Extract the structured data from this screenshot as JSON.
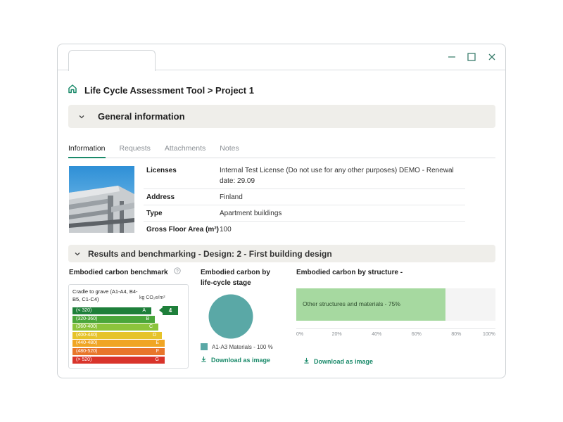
{
  "window": {
    "controls": {
      "minimize_icon": "minimize-icon",
      "maximize_icon": "maximize-icon",
      "close_icon": "close-icon"
    }
  },
  "header": {
    "home_icon": "home-icon",
    "title": "Life Cycle Assessment Tool > Project 1"
  },
  "general_section": {
    "title": "General information",
    "tabs": [
      {
        "label": "Information",
        "active": true
      },
      {
        "label": "Requests",
        "active": false
      },
      {
        "label": "Attachments",
        "active": false
      },
      {
        "label": "Notes",
        "active": false
      }
    ],
    "info": [
      {
        "key": "Licenses",
        "value": "Internal Test License (Do not use for any other purposes) DEMO - Renewal date: 29.09"
      },
      {
        "key": "Address",
        "value": "Finland"
      },
      {
        "key": "Type",
        "value": "Apartment buildings"
      },
      {
        "key": "Gross Floor Area (m²)",
        "value": "100"
      }
    ]
  },
  "results_section": {
    "title": "Results and benchmarking - Design: 2 - First building design",
    "benchmark": {
      "title": "Embodied carbon benchmark",
      "help_icon": "help-icon",
      "scope": "Cradle to grave (A1-A4, B4-B5, C1-C4)",
      "unit": "kg CO₂e/m²",
      "bands": [
        {
          "range": "(< 320)",
          "grade": "A",
          "color": "#1e7f3a"
        },
        {
          "range": "(320-360)",
          "grade": "B",
          "color": "#4aa63a"
        },
        {
          "range": "(360-400)",
          "grade": "C",
          "color": "#8cc43c"
        },
        {
          "range": "(400-440)",
          "grade": "D",
          "color": "#e6c32a"
        },
        {
          "range": "(440-480)",
          "grade": "E",
          "color": "#f0a524"
        },
        {
          "range": "(480-520)",
          "grade": "F",
          "color": "#e8762b"
        },
        {
          "range": "(> 520)",
          "grade": "G",
          "color": "#d9342b"
        }
      ],
      "marker_value": "4"
    },
    "lifecycle": {
      "title": "Embodied carbon by life-cycle stage",
      "pie_color": "#5aa8a6",
      "legend": "A1-A3 Materials - 100 %",
      "download": "Download as image",
      "download_icon": "download-icon"
    },
    "structure": {
      "title": "Embodied carbon by structure -",
      "bar_label": "Other structures and materials - 75%",
      "bar_value": 75,
      "ticks": [
        "0%",
        "20%",
        "40%",
        "60%",
        "80%",
        "100%"
      ],
      "download": "Download as image",
      "download_icon": "download-icon"
    }
  }
}
